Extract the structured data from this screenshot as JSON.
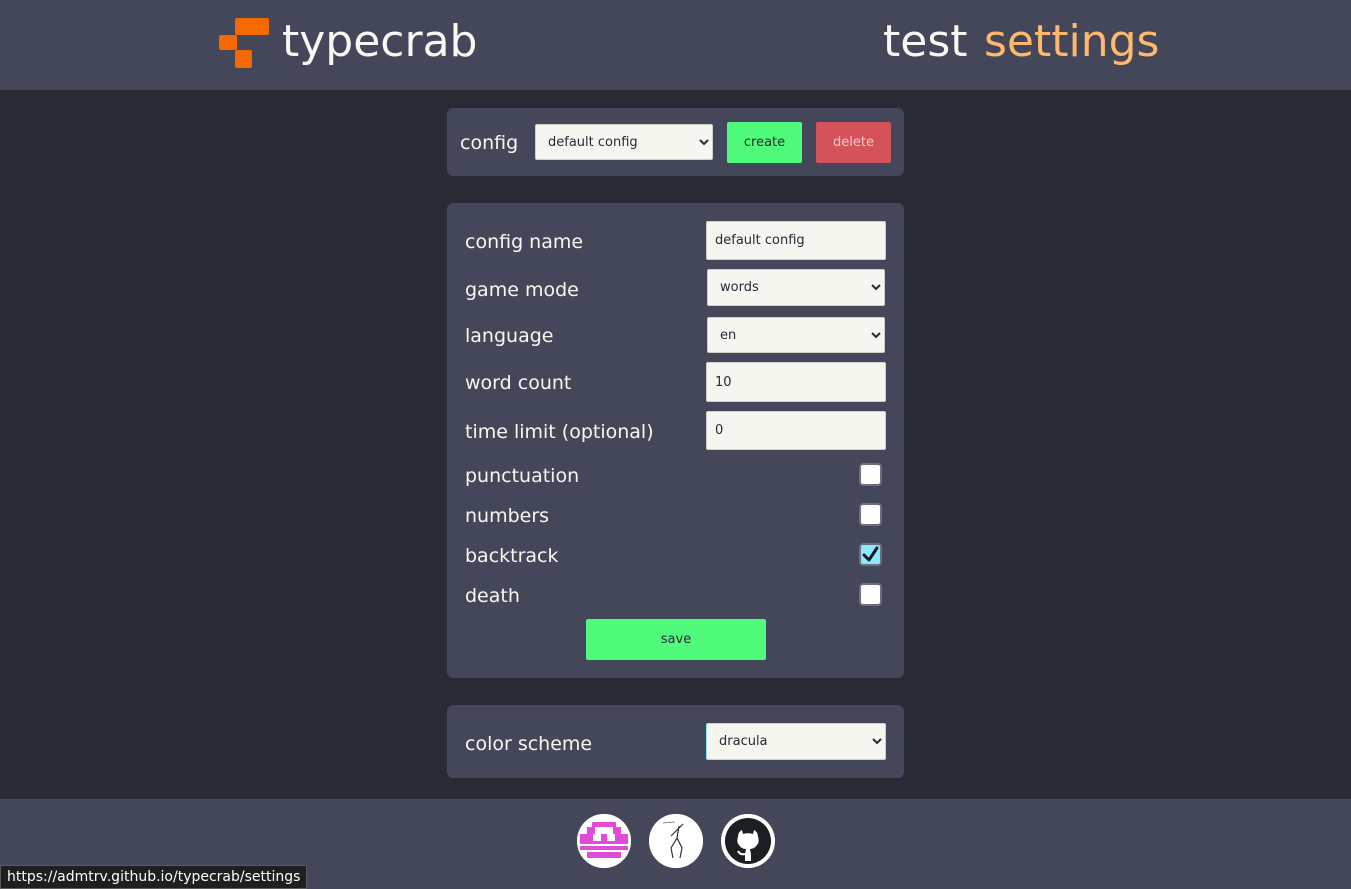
{
  "header": {
    "brand": "typecrab",
    "nav_test": "test",
    "nav_settings": "settings",
    "logo_icon": "typecrab-logo-icon",
    "accent": "#ffb86c",
    "logo_color": "#f56a00"
  },
  "config_bar": {
    "label": "config",
    "selected": "default config",
    "create_label": "create",
    "delete_label": "delete"
  },
  "settings": {
    "config_name_label": "config name",
    "config_name_value": "default config",
    "game_mode_label": "game mode",
    "game_mode_value": "words",
    "language_label": "language",
    "language_value": "en",
    "word_count_label": "word count",
    "word_count_value": "10",
    "time_limit_label": "time limit (optional)",
    "time_limit_value": "0",
    "punctuation_label": "punctuation",
    "punctuation_checked": false,
    "numbers_label": "numbers",
    "numbers_checked": false,
    "backtrack_label": "backtrack",
    "backtrack_checked": true,
    "death_label": "death",
    "death_checked": false,
    "save_label": "save"
  },
  "color_scheme": {
    "label": "color scheme",
    "selected": "dracula"
  },
  "footer": {
    "links": [
      {
        "icon": "pixel-avatar-icon"
      },
      {
        "icon": "sketch-avatar-icon"
      },
      {
        "icon": "github-icon"
      }
    ]
  },
  "status_bar": {
    "url": "https://admtrv.github.io/typecrab/settings"
  },
  "colors": {
    "background": "#282a36",
    "panel": "#44475a",
    "green": "#50fa7b",
    "red": "#d4525a",
    "cyan": "#8be9fd"
  }
}
